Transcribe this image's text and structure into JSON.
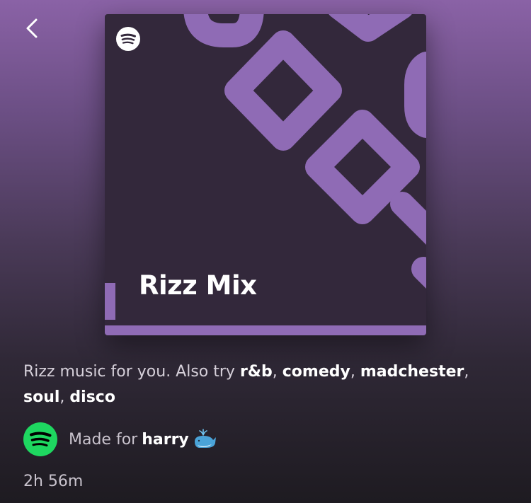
{
  "header": {
    "back_icon": "chevron-left-icon"
  },
  "cover": {
    "title": "Rizz Mix",
    "logo_icon": "spotify-logo-icon",
    "background_color": "#33283b",
    "accent_color": "#8f6bb5"
  },
  "description": {
    "prefix": "Rizz music for you. Also try ",
    "genres": [
      "r&b",
      "comedy",
      "madchester",
      "soul",
      "disco"
    ]
  },
  "made_for": {
    "avatar_icon": "spotify-logo-icon",
    "avatar_color": "#1ed760",
    "label": "Made for",
    "user": "harry",
    "emoji_icon": "whale-icon"
  },
  "duration": "2h 56m"
}
